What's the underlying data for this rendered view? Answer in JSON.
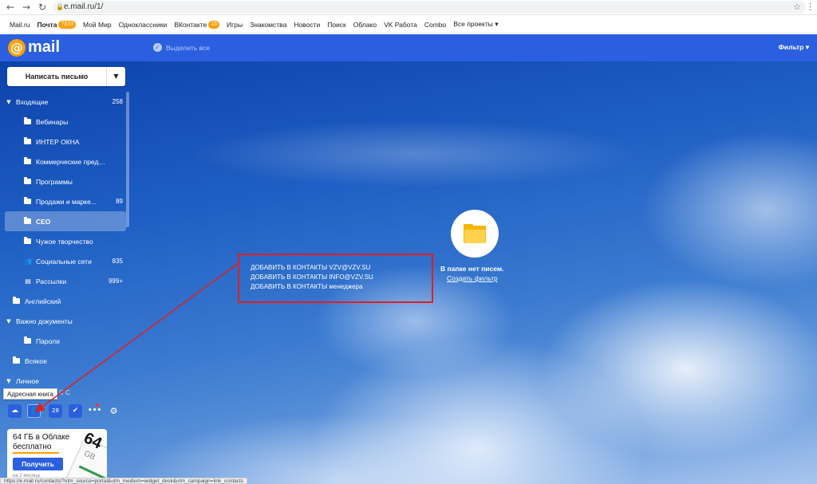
{
  "browser": {
    "back_icon": "arrow-left-icon",
    "forward_icon": "arrow-right-icon",
    "reload_icon": "reload-icon",
    "url": "e.mail.ru/1/"
  },
  "portal_menu": {
    "items": [
      {
        "label": "Mail.ru"
      },
      {
        "label": "Почта",
        "badge": "7533",
        "bold": true
      },
      {
        "label": "Мой Мир"
      },
      {
        "label": "Одноклассники"
      },
      {
        "label": "ВКонтакте",
        "badge": "15"
      },
      {
        "label": "Игры"
      },
      {
        "label": "Знакомства"
      },
      {
        "label": "Новости"
      },
      {
        "label": "Поиск"
      },
      {
        "label": "Облако"
      },
      {
        "label": "VK Работа"
      },
      {
        "label": "Combo"
      },
      {
        "label": "Все проекты ▾"
      }
    ]
  },
  "header": {
    "logo_text": "mail",
    "select_all_label": "Выделить все",
    "filter_label": "Фильтр ▾"
  },
  "compose": {
    "label": "Написать письмо",
    "dropdown_icon": "▼"
  },
  "folders": [
    {
      "label": "Входящие",
      "count": "258",
      "arrow": "▼",
      "icon": "none"
    },
    {
      "label": "Вебинары",
      "count": "",
      "icon": "folder"
    },
    {
      "label": "ИНТЕР ОКНА",
      "count": "",
      "icon": "folder"
    },
    {
      "label": "Коммерческие предл...",
      "count": "",
      "icon": "folder"
    },
    {
      "label": "Программы",
      "count": "",
      "icon": "folder"
    },
    {
      "label": "Продажи и марке...",
      "count": "89",
      "icon": "folder"
    },
    {
      "label": "CEO",
      "count": "",
      "icon": "folder",
      "active": true
    },
    {
      "label": "Чужое творчество",
      "count": "",
      "icon": "folder"
    },
    {
      "label": "Социальные сети",
      "count": "835",
      "icon": "people"
    },
    {
      "label": "Рассылки",
      "count": "999+",
      "icon": "newsletter"
    },
    {
      "label": "Английский",
      "count": "",
      "icon": "folder"
    },
    {
      "label": "Важно документы",
      "count": "",
      "arrow": "▼",
      "icon": "none"
    },
    {
      "label": "Пароли",
      "count": "",
      "icon": "folder"
    },
    {
      "label": "Всякое",
      "count": "",
      "icon": "folder"
    },
    {
      "label": "Личное",
      "count": "",
      "arrow": "▼",
      "icon": "none"
    }
  ],
  "tooltip": {
    "label": "Адресная книга",
    "extra": "C C"
  },
  "tools": [
    {
      "name": "cloud-icon",
      "glyph": "☁"
    },
    {
      "name": "address-book-icon",
      "glyph": "👤"
    },
    {
      "name": "calendar-icon",
      "glyph": "28"
    },
    {
      "name": "tasks-icon",
      "glyph": "✔"
    },
    {
      "name": "more-icon",
      "glyph": "•••"
    },
    {
      "name": "settings-icon",
      "glyph": "⚙"
    }
  ],
  "promo": {
    "title": "64 ГБ в Облаке бесплатно",
    "button": "Получить",
    "note": "на 2 месяца",
    "big_number": "64",
    "unit": "GB"
  },
  "status_bar": {
    "url": "https://e.mail.ru/contacts/?utm_source=portal&utm_medium=widget_desk&utm_campaign=link_contacts"
  },
  "empty_state": {
    "title": "В папке нет писем.",
    "link": "Создать фильтр"
  },
  "annotation": {
    "lines": [
      "ДОБАВИТЬ В КОНТАКТЫ VZV@VZV.SU",
      "ДОБАВИТЬ В КОНТАКТЫ INFO@VZV.SU",
      "ДОБАВИТЬ В КОНТАКТЫ менеджера"
    ],
    "color": "#e02020"
  },
  "colors": {
    "accent": "#2b5fe0",
    "brand_orange": "#ff9e00"
  }
}
